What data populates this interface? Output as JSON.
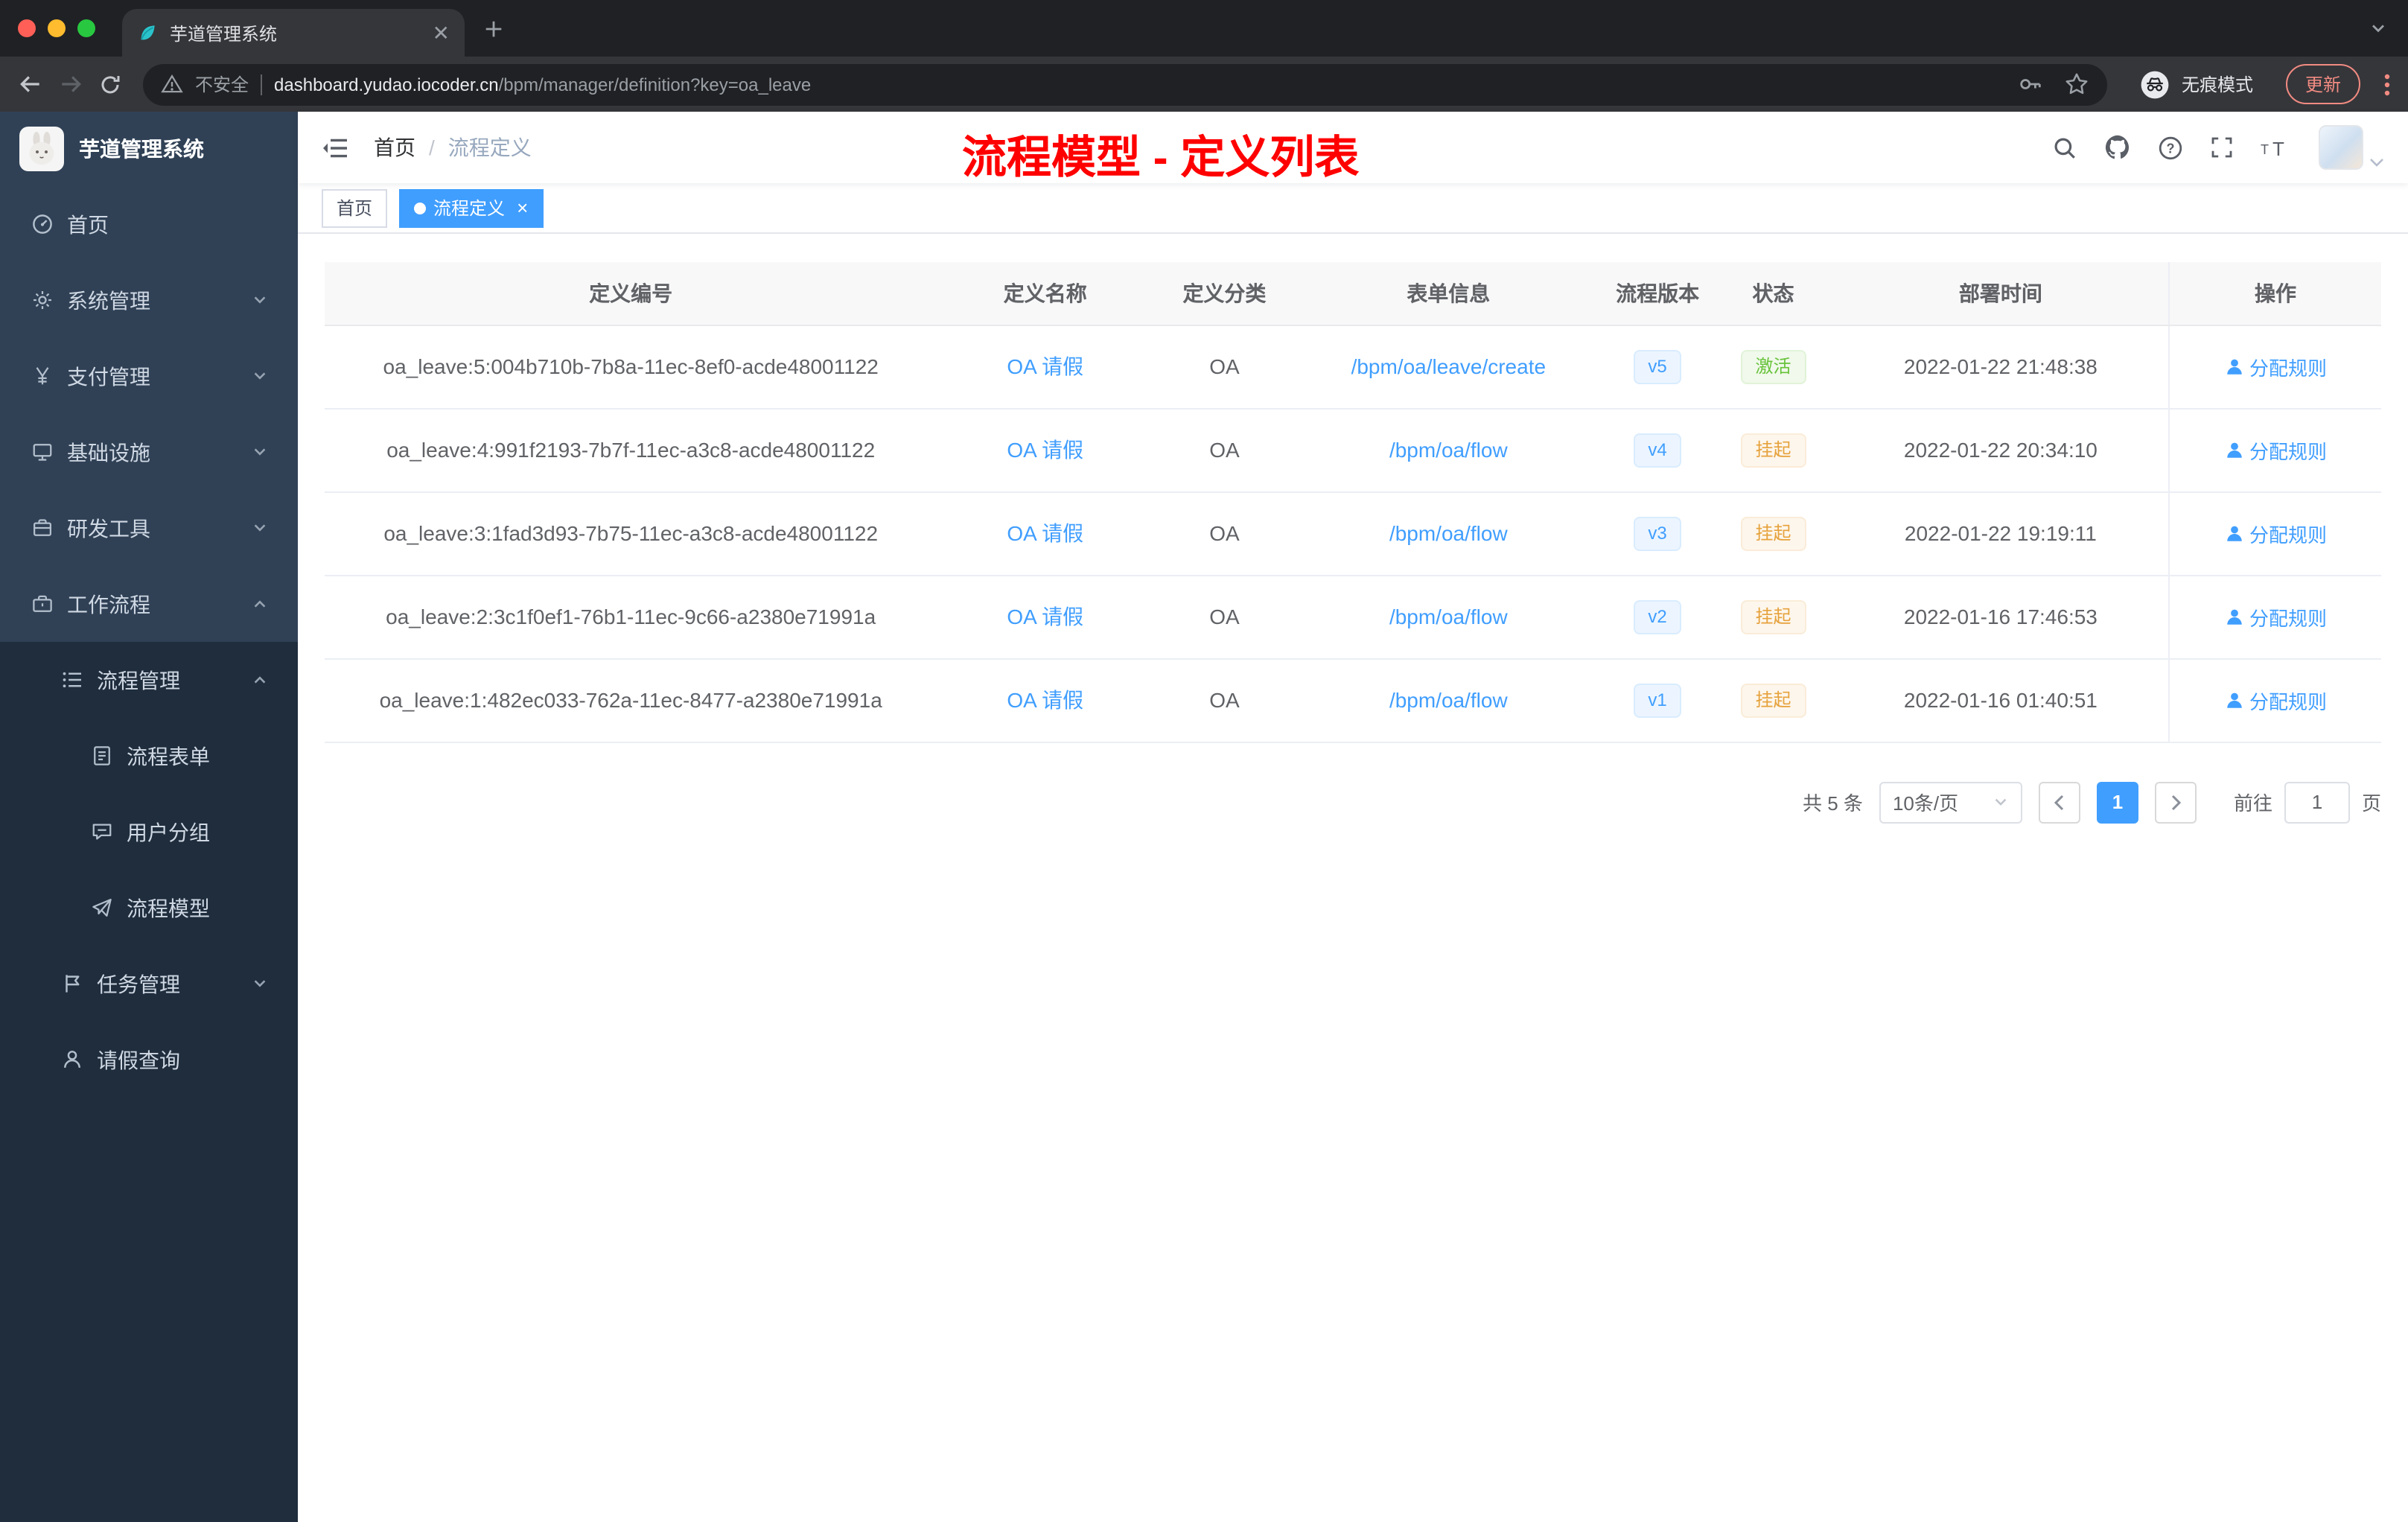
{
  "colors": {
    "accent": "#409eff",
    "annotation": "#ff0000",
    "success": "#67c23a",
    "warning": "#e6a23c",
    "sidebar_bg": "#304156",
    "sidebar_submenu_bg": "#1f2d3d"
  },
  "browser": {
    "tab_title": "芋道管理系统",
    "security_label": "不安全",
    "url_domain": "dashboard.yudao.iocoder.cn",
    "url_path": "/bpm/manager/definition?key=oa_leave",
    "incognito_label": "无痕模式",
    "update_label": "更新"
  },
  "sidebar": {
    "app_title": "芋道管理系统",
    "items": [
      {
        "key": "home",
        "icon": "dashboard",
        "label": "首页",
        "level": 0,
        "chevron": null,
        "dark": false
      },
      {
        "key": "system-management",
        "icon": "gear",
        "label": "系统管理",
        "level": 0,
        "chevron": "down",
        "dark": false
      },
      {
        "key": "payment-management",
        "icon": "yen",
        "label": "支付管理",
        "level": 0,
        "chevron": "down",
        "dark": false
      },
      {
        "key": "infrastructure",
        "icon": "infrastructure",
        "label": "基础设施",
        "level": 0,
        "chevron": "down",
        "dark": false
      },
      {
        "key": "dev-tools",
        "icon": "devtools",
        "label": "研发工具",
        "level": 0,
        "chevron": "down",
        "dark": false
      },
      {
        "key": "workflow",
        "icon": "workflow",
        "label": "工作流程",
        "level": 0,
        "chevron": "up",
        "dark": false
      },
      {
        "key": "process-management",
        "icon": "process",
        "label": "流程管理",
        "level": 1,
        "chevron": "up",
        "dark": true
      },
      {
        "key": "process-form",
        "icon": "form",
        "label": "流程表单",
        "level": 2,
        "chevron": null,
        "dark": true
      },
      {
        "key": "user-group",
        "icon": "usergroup",
        "label": "用户分组",
        "level": 2,
        "chevron": null,
        "dark": true
      },
      {
        "key": "process-model",
        "icon": "model",
        "label": "流程模型",
        "level": 2,
        "chevron": null,
        "dark": true
      },
      {
        "key": "task-management",
        "icon": "task",
        "label": "任务管理",
        "level": 1,
        "chevron": "down",
        "dark": true
      },
      {
        "key": "leave-query",
        "icon": "person",
        "label": "请假查询",
        "level": 1,
        "chevron": null,
        "dark": true
      }
    ]
  },
  "header": {
    "breadcrumb_home": "首页",
    "breadcrumb_separator": "/",
    "breadcrumb_current": "流程定义",
    "annotation": "流程模型 - 定义列表"
  },
  "tags": [
    {
      "label": "首页",
      "active": false
    },
    {
      "label": "流程定义",
      "active": true
    }
  ],
  "table": {
    "columns": [
      "定义编号",
      "定义名称",
      "定义分类",
      "表单信息",
      "流程版本",
      "状态",
      "部署时间",
      "操作"
    ],
    "rows": [
      {
        "id": "oa_leave:5:004b710b-7b8a-11ec-8ef0-acde48001122",
        "name": "OA 请假",
        "category": "OA",
        "form": "/bpm/oa/leave/create",
        "version": "v5",
        "status": "激活",
        "status_type": "success",
        "deploy_time": "2022-01-22 21:48:38",
        "action": "分配规则"
      },
      {
        "id": "oa_leave:4:991f2193-7b7f-11ec-a3c8-acde48001122",
        "name": "OA 请假",
        "category": "OA",
        "form": "/bpm/oa/flow",
        "version": "v4",
        "status": "挂起",
        "status_type": "warning",
        "deploy_time": "2022-01-22 20:34:10",
        "action": "分配规则"
      },
      {
        "id": "oa_leave:3:1fad3d93-7b75-11ec-a3c8-acde48001122",
        "name": "OA 请假",
        "category": "OA",
        "form": "/bpm/oa/flow",
        "version": "v3",
        "status": "挂起",
        "status_type": "warning",
        "deploy_time": "2022-01-22 19:19:11",
        "action": "分配规则"
      },
      {
        "id": "oa_leave:2:3c1f0ef1-76b1-11ec-9c66-a2380e71991a",
        "name": "OA 请假",
        "category": "OA",
        "form": "/bpm/oa/flow",
        "version": "v2",
        "status": "挂起",
        "status_type": "warning",
        "deploy_time": "2022-01-16 17:46:53",
        "action": "分配规则"
      },
      {
        "id": "oa_leave:1:482ec033-762a-11ec-8477-a2380e71991a",
        "name": "OA 请假",
        "category": "OA",
        "form": "/bpm/oa/flow",
        "version": "v1",
        "status": "挂起",
        "status_type": "warning",
        "deploy_time": "2022-01-16 01:40:51",
        "action": "分配规则"
      }
    ]
  },
  "pagination": {
    "total": "共 5 条",
    "page_size": "10条/页",
    "current_page": "1",
    "goto_label": "前往",
    "goto_value": "1",
    "unit_label": "页"
  }
}
